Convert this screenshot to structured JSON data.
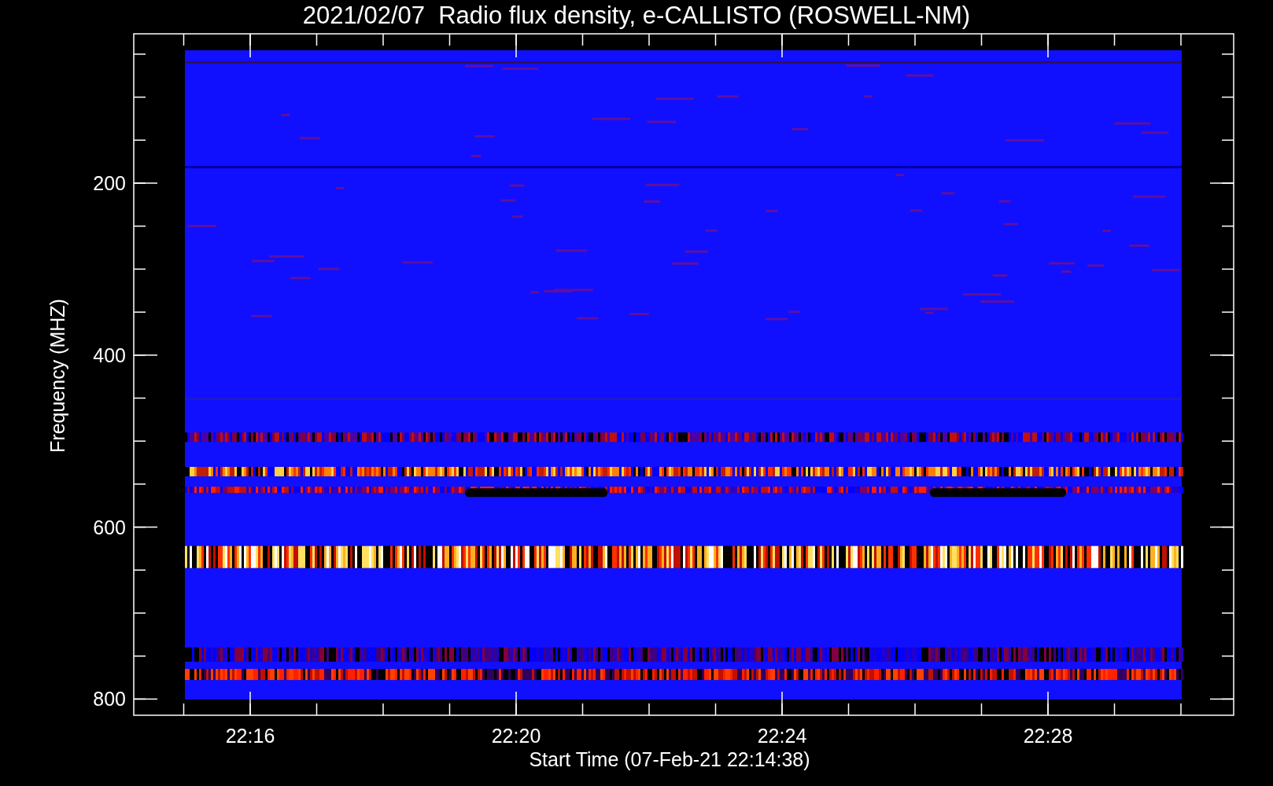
{
  "title": "2021/02/07  Radio flux density, e-CALLISTO (ROSWELL-NM)",
  "y_axis": {
    "label": "Frequency (MHZ)",
    "tick_labels": [
      "200",
      "400",
      "600",
      "800"
    ]
  },
  "x_axis": {
    "label": "Start Time (07-Feb-21 22:14:38)",
    "tick_labels": [
      "22:16",
      "22:20",
      "22:24",
      "22:28"
    ]
  }
}
